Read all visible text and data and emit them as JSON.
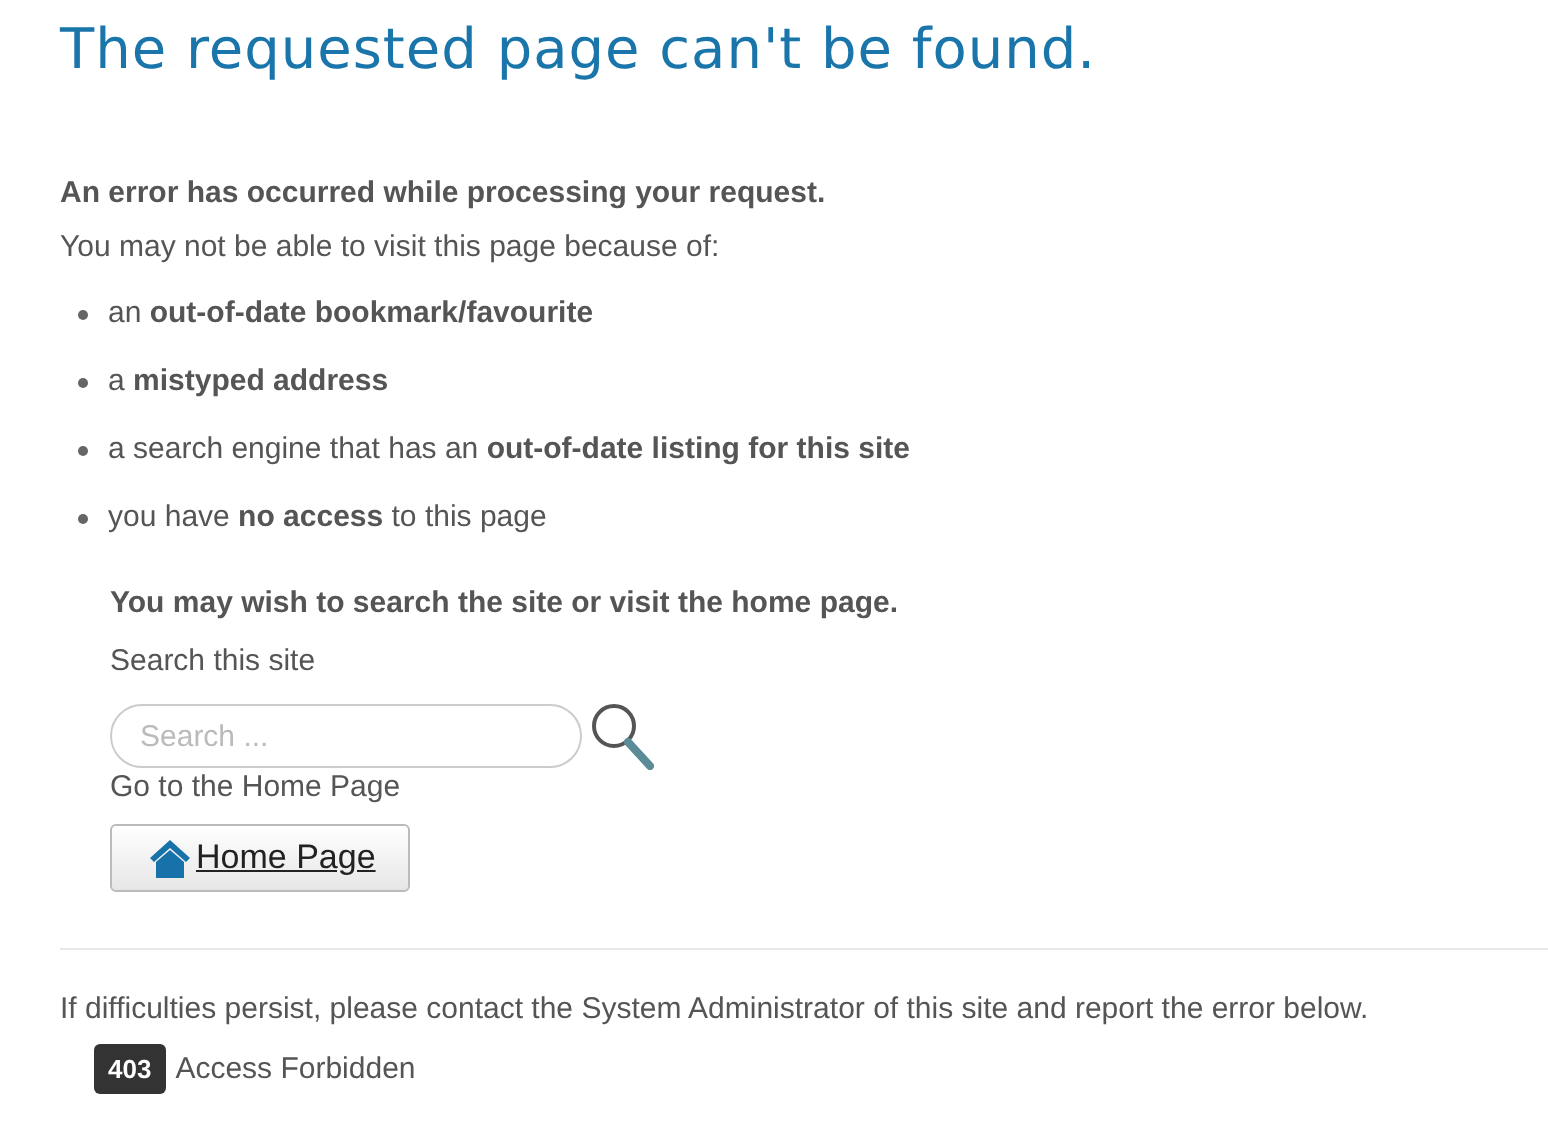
{
  "title": "The requested page can't be found.",
  "error_heading": "An error has occurred while processing your request.",
  "intro": "You may not be able to visit this page because of:",
  "reasons": [
    "an **out-of-date bookmark/favourite**",
    "a **mistyped address**",
    "a search engine that has an **out-of-date listing for this site**",
    "you have **no access** to this page"
  ],
  "suggestion": "You may wish to search the site or visit the home page.",
  "search": {
    "label": "Search this site",
    "placeholder": "Search ..."
  },
  "home": {
    "label": "Go to the Home Page",
    "button": "Home Page"
  },
  "footer": {
    "message": "If difficulties persist, please contact the System Administrator of this site and report the error below.",
    "code": "403",
    "error": "Access Forbidden"
  }
}
